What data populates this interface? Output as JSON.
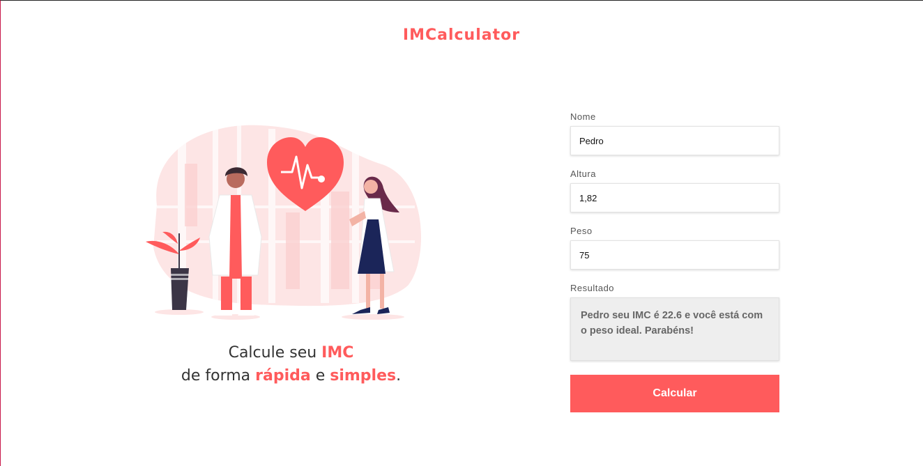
{
  "header": {
    "title": "IMCalculator"
  },
  "hero": {
    "line1_prefix": "Calcule seu ",
    "line1_highlight": "IMC",
    "line2_prefix": "de forma ",
    "line2_highlight1": "rápida",
    "line2_mid": " e ",
    "line2_highlight2": "simples",
    "line2_suffix": "."
  },
  "form": {
    "nome_label": "Nome",
    "nome_value": "Pedro",
    "altura_label": "Altura",
    "altura_value": "1,82",
    "peso_label": "Peso",
    "peso_value": "75",
    "resultado_label": "Resultado",
    "resultado_text": "Pedro seu IMC é 22.6 e você está com o peso ideal. Parabéns!",
    "submit_label": "Calcular"
  },
  "colors": {
    "accent": "#ff5b5c",
    "text": "#333333",
    "result_bg": "#eeeeee"
  }
}
